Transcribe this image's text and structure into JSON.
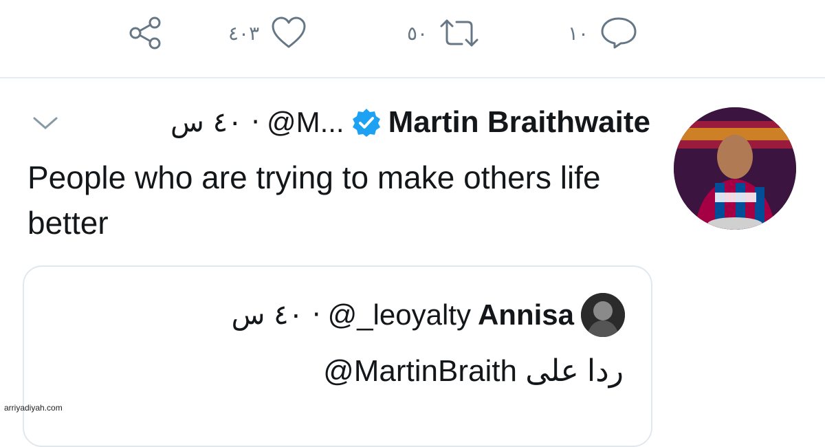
{
  "actions": {
    "share": {
      "icon": "share-icon"
    },
    "like": {
      "count": "٤٠٣",
      "icon": "heart-icon"
    },
    "retweet": {
      "count": "٥٠",
      "icon": "retweet-icon"
    },
    "reply": {
      "count": "١٠",
      "icon": "reply-bubble-icon"
    }
  },
  "tweet": {
    "author_name": "Martin Braithwaite",
    "author_handle": "@M...",
    "time_meta": "· ٤٠ س",
    "text": "People who are trying to make others life better"
  },
  "quote": {
    "author_name": "Annisa",
    "author_handle": "@_leoyalty",
    "time_meta": "· ٤٠ س",
    "reply_prefix": "ردا على",
    "reply_mention": "@MartinBraith"
  },
  "watermark": "arriyadiyah.com",
  "colors": {
    "verified": "#1da1f2",
    "icon_gray": "#657786",
    "divider": "#e6ecf0"
  }
}
